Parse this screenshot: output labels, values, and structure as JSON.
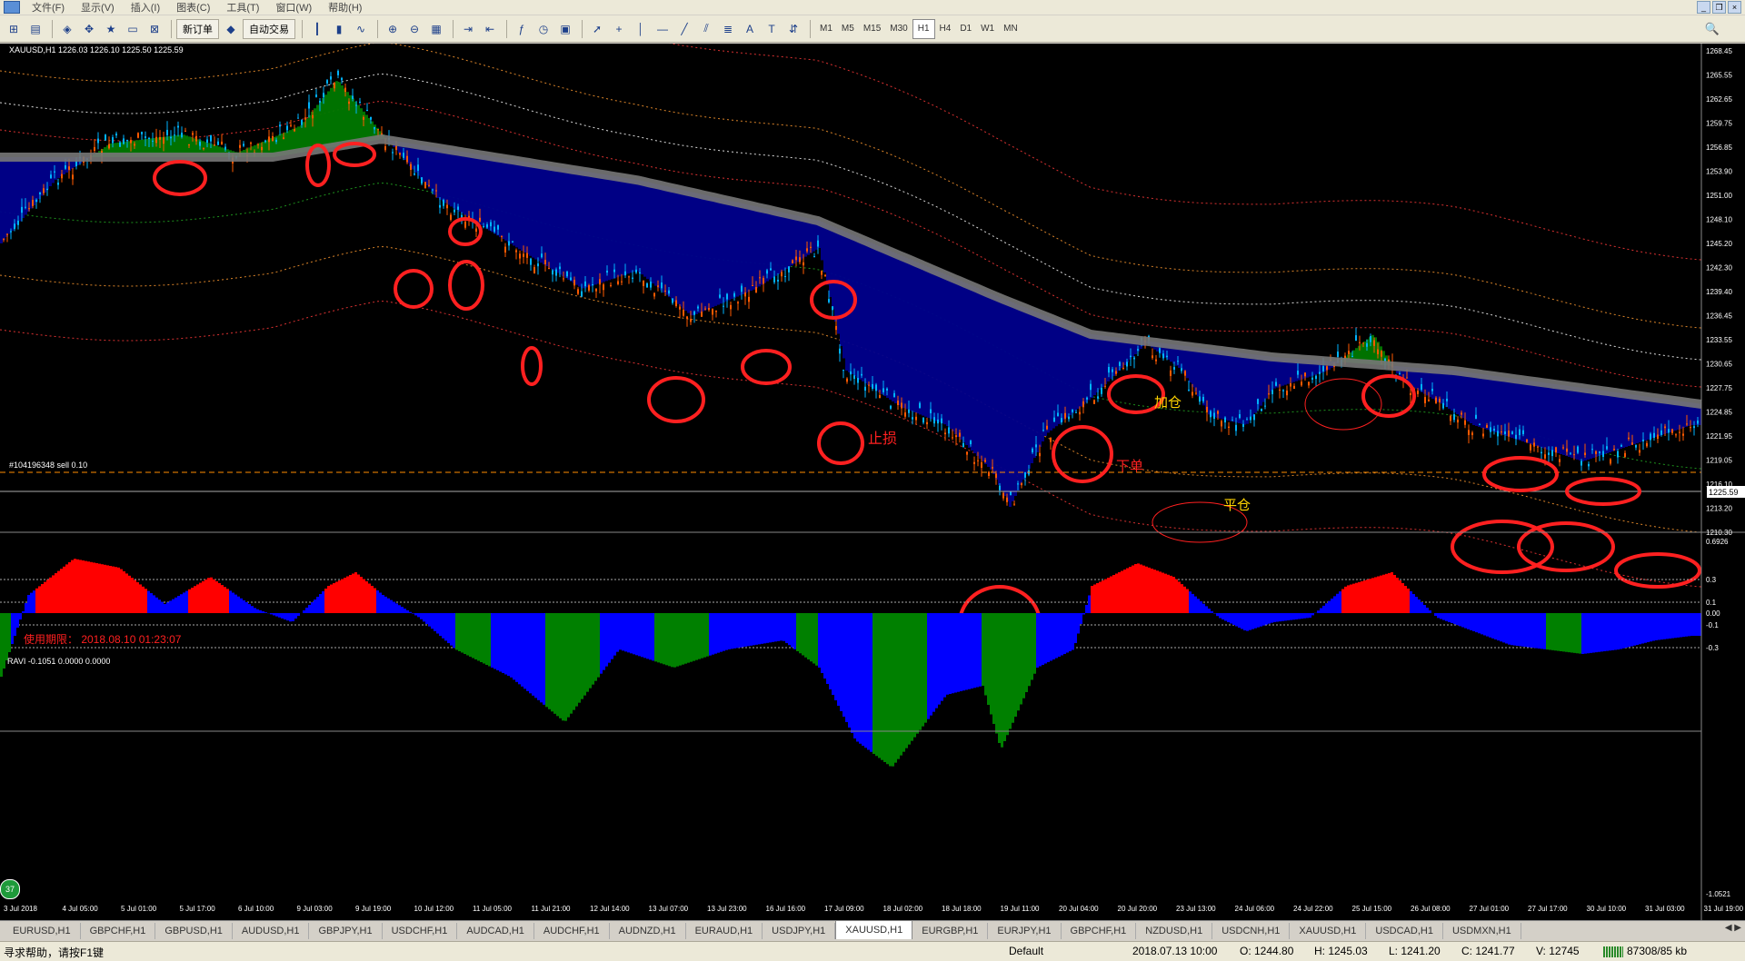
{
  "menu": [
    "文件(F)",
    "显示(V)",
    "插入(I)",
    "图表(C)",
    "工具(T)",
    "窗口(W)",
    "帮助(H)"
  ],
  "toolbar": {
    "new_order": "新订单",
    "auto_trade": "自动交易",
    "timeframes": [
      "M1",
      "M5",
      "M15",
      "M30",
      "H1",
      "H4",
      "D1",
      "W1",
      "MN"
    ],
    "active_timeframe": "H1"
  },
  "chart": {
    "header": "XAUUSD,H1  1226.03 1226.10 1225.50 1225.59",
    "order_label": "#104196348 sell 0.10",
    "expiry": "使用期限： 2018.08.10 01:23:07",
    "current_price": "1225.59",
    "annotations": {
      "add": "加仓",
      "stop": "止损",
      "entry": "下单",
      "close": "平仓"
    },
    "price_ticks": [
      "1268.45",
      "1265.55",
      "1262.65",
      "1259.75",
      "1256.85",
      "1253.90",
      "1251.00",
      "1248.10",
      "1245.20",
      "1242.30",
      "1239.40",
      "1236.45",
      "1233.55",
      "1230.65",
      "1227.75",
      "1224.85",
      "1221.95",
      "1219.05",
      "1216.10",
      "1213.20",
      "1210.30"
    ],
    "indicator_header": "RAVI -0.1051 0.0000 0.0000",
    "indicator_ticks": [
      "0.6926",
      "0.3",
      "0.1",
      "0.00",
      "-0.1",
      "-0.3",
      "-1.0521"
    ],
    "time_ticks": [
      "3 Jul 2018",
      "4 Jul 05:00",
      "5 Jul 01:00",
      "5 Jul 17:00",
      "6 Jul 10:00",
      "9 Jul 03:00",
      "9 Jul 19:00",
      "10 Jul 12:00",
      "11 Jul 05:00",
      "11 Jul 21:00",
      "12 Jul 14:00",
      "13 Jul 07:00",
      "13 Jul 23:00",
      "16 Jul 16:00",
      "17 Jul 09:00",
      "18 Jul 02:00",
      "18 Jul 18:00",
      "19 Jul 11:00",
      "20 Jul 04:00",
      "20 Jul 20:00",
      "23 Jul 13:00",
      "24 Jul 06:00",
      "24 Jul 22:00",
      "25 Jul 15:00",
      "26 Jul 08:00",
      "27 Jul 01:00",
      "27 Jul 17:00",
      "30 Jul 10:00",
      "31 Jul 03:00",
      "31 Jul 19:00"
    ]
  },
  "colors": {
    "bg": "#000000",
    "bull": "#ff5a00",
    "bear": "#00b4ff",
    "cloud_bear": "#00008c",
    "cloud_bull": "#007800",
    "ma": "#777777",
    "circle": "#ff2020",
    "ravi_red": "#ff0000",
    "ravi_blue": "#0000ff",
    "ravi_green": "#008000"
  },
  "tabs": [
    "EURUSD,H1",
    "GBPCHF,H1",
    "GBPUSD,H1",
    "AUDUSD,H1",
    "GBPJPY,H1",
    "USDCHF,H1",
    "AUDCAD,H1",
    "AUDCHF,H1",
    "AUDNZD,H1",
    "EURAUD,H1",
    "USDJPY,H1",
    "XAUUSD,H1",
    "EURGBP,H1",
    "EURJPY,H1",
    "GBPCHF,H1",
    "NZDUSD,H1",
    "USDCNH,H1",
    "XAUUSD,H1",
    "USDCAD,H1",
    "USDMXN,H1"
  ],
  "active_tab": "XAUUSD,H1",
  "status": {
    "help": "寻求帮助，请按F1键",
    "profile": "Default",
    "datetime": "2018.07.13 10:00",
    "open": "O: 1244.80",
    "high": "H: 1245.03",
    "low": "L: 1241.20",
    "close": "C: 1241.77",
    "volume": "V: 12745",
    "traffic": "87308/85 kb"
  },
  "badge": "37"
}
